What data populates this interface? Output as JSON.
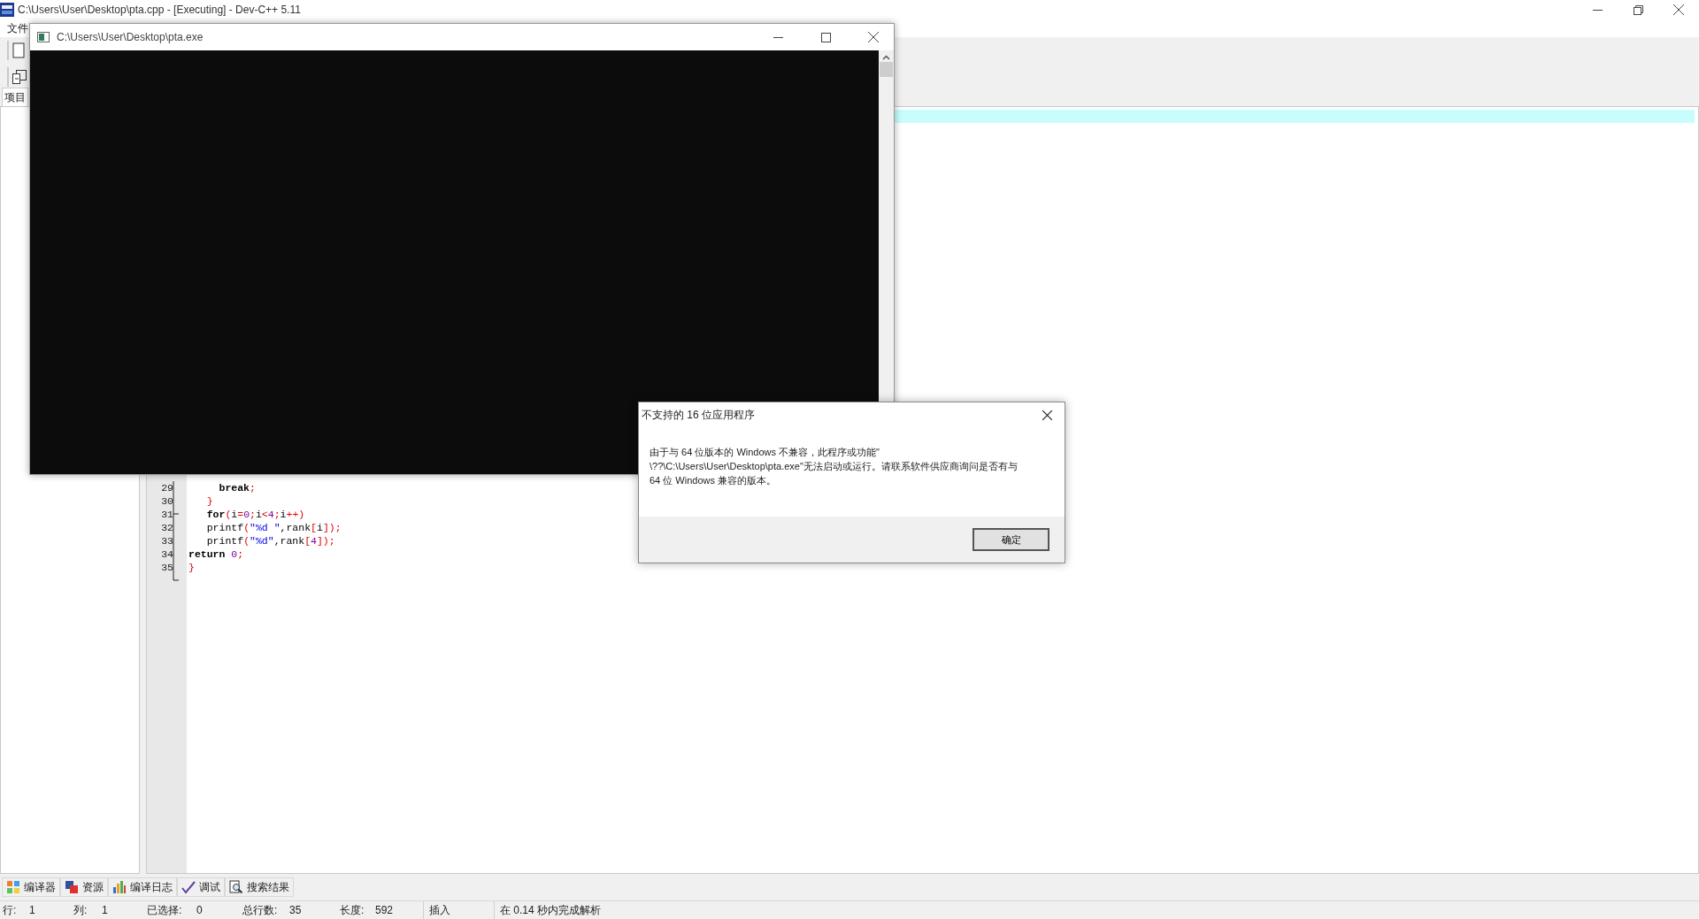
{
  "window": {
    "title": "C:\\Users\\User\\Desktop\\pta.cpp - [Executing] - Dev-C++ 5.11"
  },
  "menu": [
    "文件"
  ],
  "project_panel": {
    "tab": "项目"
  },
  "editor": {
    "lines": [
      {
        "number": "29",
        "tokens": [
          {
            "kind": "keyword",
            "text": "     break"
          },
          {
            "kind": "sym",
            "text": ";"
          }
        ]
      },
      {
        "number": "30",
        "tokens": [
          {
            "kind": "sym",
            "text": "   }"
          }
        ]
      },
      {
        "number": "31",
        "tokens": [
          {
            "kind": "keyword",
            "text": "   for"
          },
          {
            "kind": "sym",
            "text": "("
          },
          {
            "kind": "ident",
            "text": "i"
          },
          {
            "kind": "sym",
            "text": "="
          },
          {
            "kind": "number",
            "text": "0"
          },
          {
            "kind": "sym",
            "text": ";"
          },
          {
            "kind": "ident",
            "text": "i"
          },
          {
            "kind": "sym",
            "text": "<"
          },
          {
            "kind": "number",
            "text": "4"
          },
          {
            "kind": "sym",
            "text": ";"
          },
          {
            "kind": "ident",
            "text": "i"
          },
          {
            "kind": "sym",
            "text": "++)"
          }
        ]
      },
      {
        "number": "32",
        "tokens": [
          {
            "kind": "ident",
            "text": "   printf"
          },
          {
            "kind": "sym",
            "text": "("
          },
          {
            "kind": "string",
            "text": "\"%d \""
          },
          {
            "kind": "ident",
            "text": ",rank"
          },
          {
            "kind": "sym",
            "text": "["
          },
          {
            "kind": "ident",
            "text": "i"
          },
          {
            "kind": "sym",
            "text": "]);"
          }
        ]
      },
      {
        "number": "33",
        "tokens": [
          {
            "kind": "ident",
            "text": "   printf"
          },
          {
            "kind": "sym",
            "text": "("
          },
          {
            "kind": "string",
            "text": "\"%d\""
          },
          {
            "kind": "ident",
            "text": ",rank"
          },
          {
            "kind": "sym",
            "text": "["
          },
          {
            "kind": "number",
            "text": "4"
          },
          {
            "kind": "sym",
            "text": "]);"
          }
        ]
      },
      {
        "number": "34",
        "tokens": [
          {
            "kind": "keyword",
            "text": "return"
          },
          {
            "kind": "number",
            "text": " 0"
          },
          {
            "kind": "sym",
            "text": ";"
          }
        ]
      },
      {
        "number": "35",
        "tokens": [
          {
            "kind": "sym",
            "text": "}"
          }
        ]
      }
    ]
  },
  "console_window": {
    "title": "C:\\Users\\User\\Desktop\\pta.exe"
  },
  "dialog": {
    "title": "不支持的 16 位应用程序",
    "message": [
      "由于与 64 位版本的 Windows 不兼容，此程序或功能\"",
      "\\??\\C:\\Users\\User\\Desktop\\pta.exe\"无法启动或运行。请联系软件供应商询问是否有与",
      "64 位 Windows 兼容的版本。"
    ],
    "button": "确定"
  },
  "bottom_tabs": [
    {
      "label": "编译器"
    },
    {
      "label": "资源"
    },
    {
      "label": "编译日志"
    },
    {
      "label": "调试"
    },
    {
      "label": "搜索结果"
    }
  ],
  "status_bar": [
    {
      "kind": "pair",
      "label": "行:",
      "value": "1"
    },
    {
      "kind": "pair",
      "label": "列:",
      "value": "1"
    },
    {
      "kind": "pair",
      "label": "已选择:",
      "value": "0"
    },
    {
      "kind": "pair",
      "label": "总行数:",
      "value": "35"
    },
    {
      "kind": "pair",
      "label": "长度:",
      "value": "592"
    },
    {
      "kind": "text",
      "text": "插入"
    },
    {
      "kind": "text",
      "text": "在 0.14 秒内完成解析"
    }
  ]
}
